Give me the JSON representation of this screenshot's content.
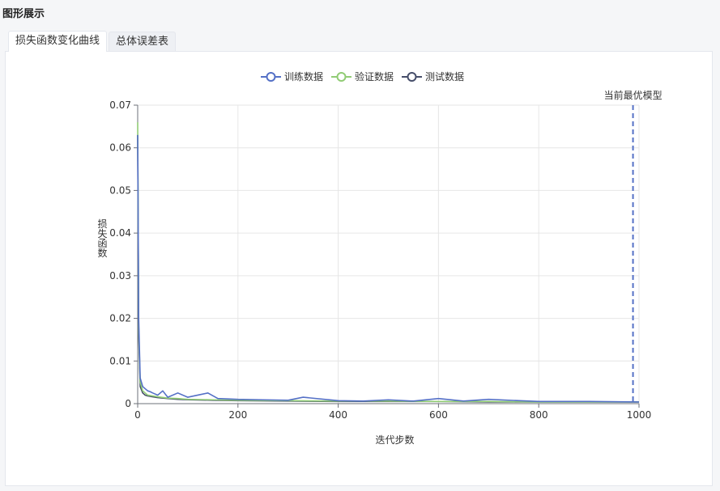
{
  "page": {
    "title": "图形展示"
  },
  "tabs": [
    {
      "label": "损失函数变化曲线",
      "active": true
    },
    {
      "label": "总体误差表",
      "active": false
    }
  ],
  "chart_data": {
    "type": "line",
    "ylabel": "损失函数",
    "xlabel": "迭代步数",
    "xlim": [
      0,
      1000
    ],
    "ylim": [
      0,
      0.07
    ],
    "x_ticks": [
      0,
      200,
      400,
      600,
      800,
      1000
    ],
    "y_ticks": [
      0,
      0.01,
      0.02,
      0.03,
      0.04,
      0.05,
      0.06,
      0.07
    ],
    "y_tick_labels": [
      "0",
      "0.01",
      "0.02",
      "0.03",
      "0.04",
      "0.05",
      "0.06",
      "0.07"
    ],
    "grid": true,
    "legend_position": "top-center",
    "mark_line": {
      "x": 988,
      "label": "当前最优模型",
      "color": "#5470c6"
    },
    "series": [
      {
        "name": "训练数据",
        "color": "#5470c6",
        "x": [
          0,
          2,
          5,
          10,
          15,
          20,
          25,
          30,
          40,
          50,
          60,
          80,
          100,
          120,
          140,
          160,
          200,
          250,
          300,
          330,
          400,
          450,
          500,
          550,
          600,
          650,
          700,
          800,
          900,
          1000
        ],
        "y": [
          0.063,
          0.02,
          0.006,
          0.004,
          0.0035,
          0.003,
          0.0028,
          0.0025,
          0.002,
          0.003,
          0.0015,
          0.0025,
          0.0015,
          0.002,
          0.0025,
          0.0012,
          0.001,
          0.0009,
          0.0008,
          0.0015,
          0.0007,
          0.0006,
          0.0009,
          0.0006,
          0.0012,
          0.0006,
          0.001,
          0.0005,
          0.0005,
          0.0004
        ]
      },
      {
        "name": "验证数据",
        "color": "#91cc75",
        "x": [
          0,
          2,
          5,
          10,
          15,
          20,
          30,
          40,
          60,
          80,
          100,
          150,
          200,
          300,
          400,
          500,
          600,
          700,
          800,
          900,
          1000
        ],
        "y": [
          0.066,
          0.018,
          0.005,
          0.003,
          0.0025,
          0.002,
          0.0018,
          0.0016,
          0.0013,
          0.0012,
          0.001,
          0.0009,
          0.0008,
          0.0007,
          0.0006,
          0.0006,
          0.0005,
          0.0005,
          0.0004,
          0.0004,
          0.0004
        ]
      },
      {
        "name": "测试数据",
        "color": "#464e6a",
        "x": [
          0,
          2,
          5,
          10,
          15,
          20,
          30,
          40,
          60,
          80,
          100,
          150,
          200,
          300,
          400,
          500,
          600,
          700,
          800,
          900,
          1000
        ],
        "y": [
          0.063,
          0.016,
          0.004,
          0.0025,
          0.002,
          0.0018,
          0.0016,
          0.0014,
          0.0012,
          0.001,
          0.0009,
          0.0008,
          0.0007,
          0.0006,
          0.0005,
          0.0005,
          0.0005,
          0.0004,
          0.0004,
          0.0004,
          0.0004
        ]
      }
    ]
  }
}
